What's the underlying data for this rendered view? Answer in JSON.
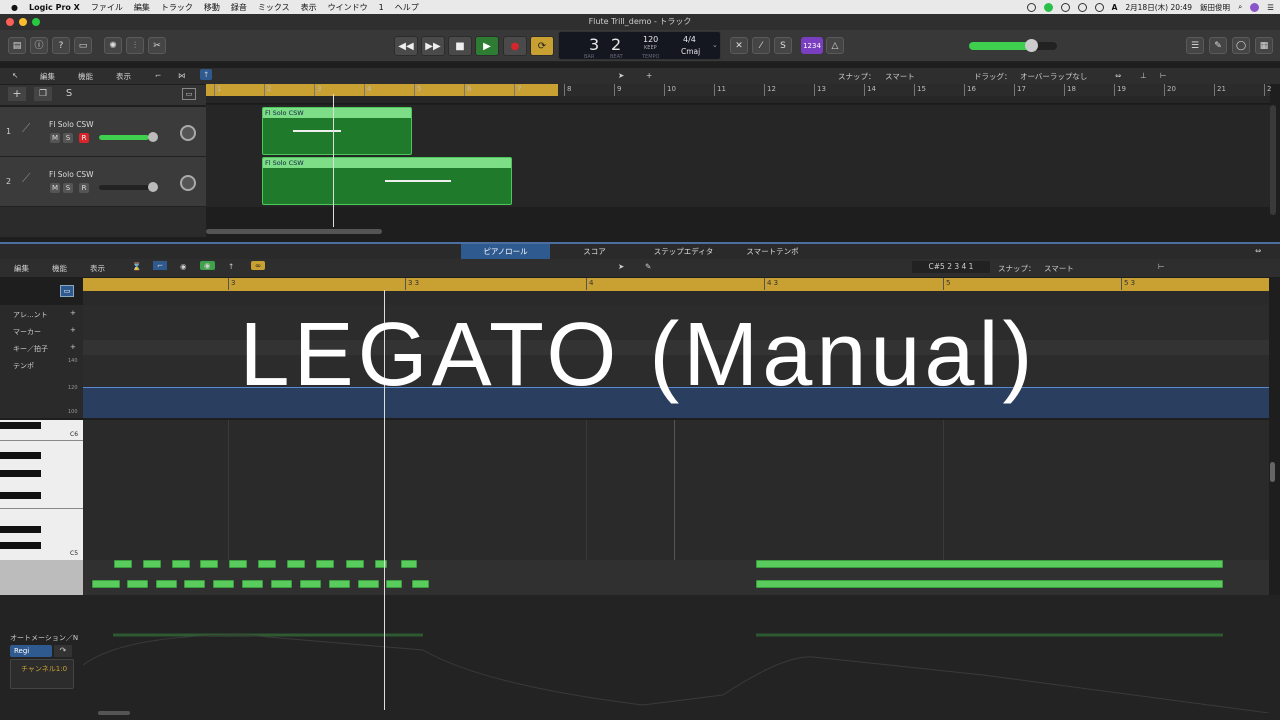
{
  "menubar": {
    "apple": "",
    "app": "Logic Pro X",
    "items": [
      "ファイル",
      "編集",
      "トラック",
      "移動",
      "録音",
      "ミックス",
      "表示",
      "ウインドウ",
      "1",
      "ヘルプ"
    ],
    "clock": "2月18日(木) 20:49",
    "user": "飯田俊明"
  },
  "window": {
    "title": "Flute Trill_demo - トラック"
  },
  "lcd": {
    "bar": "3",
    "beat": "2",
    "bar_label": "BAR",
    "beat_label": "BEAT",
    "tempo": "120",
    "tempo_mode": "KEEP",
    "tempo_label": "TEMPO",
    "signature": "4/4",
    "key": "Cmaj"
  },
  "badge": "1234",
  "tracks_header": {
    "edit": "編集",
    "functions": "機能",
    "view": "表示",
    "snap_label": "スナップ：",
    "snap": "スマート",
    "drag_label": "ドラッグ：",
    "drag": "オーバーラップなし"
  },
  "ruler_tracks": [
    "1",
    "2",
    "3",
    "4",
    "5",
    "6",
    "7",
    "8",
    "9",
    "10",
    "11",
    "12",
    "13",
    "14",
    "15",
    "16",
    "17",
    "18",
    "19",
    "20",
    "21",
    "2"
  ],
  "tracks": [
    {
      "num": "1",
      "name": "Fl Solo CSW",
      "m": "M",
      "s": "S",
      "r": "R"
    },
    {
      "num": "2",
      "name": "Fl Solo CSW",
      "m": "M",
      "s": "S",
      "r": "R"
    }
  ],
  "regions": [
    {
      "label": "Fl Solo CSW"
    },
    {
      "label": "Fl Solo CSW"
    }
  ],
  "pianoroll_tabs": [
    "ピアノロール",
    "スコア",
    "ステップエディタ",
    "スマートテンポ"
  ],
  "pr_header": {
    "edit": "編集",
    "functions": "機能",
    "view": "表示",
    "position": "C#5  2 3 4 1",
    "snap_label": "スナップ：",
    "snap": "スマート"
  },
  "pr_ruler": [
    "3",
    "3 3",
    "4",
    "4 3",
    "5",
    "5 3"
  ],
  "globals": {
    "arrange": "アレ...ント",
    "marker": "マーカー",
    "key": "キー／拍子",
    "tempo": "テンポ",
    "tempo_ticks": [
      "140",
      "120",
      "100"
    ]
  },
  "keys": {
    "c6": "C6",
    "c5": "C5"
  },
  "automation": {
    "label": "オートメーション／N",
    "region": "Regi",
    "channel": "チャンネル1:0"
  },
  "overlay_title": "LEGATO (Manual)",
  "colors": {
    "accent_green": "#5acb5d",
    "ruler_gold": "#c9a132",
    "tab_blue": "#2f5a8f",
    "record_red": "#d7262b"
  }
}
